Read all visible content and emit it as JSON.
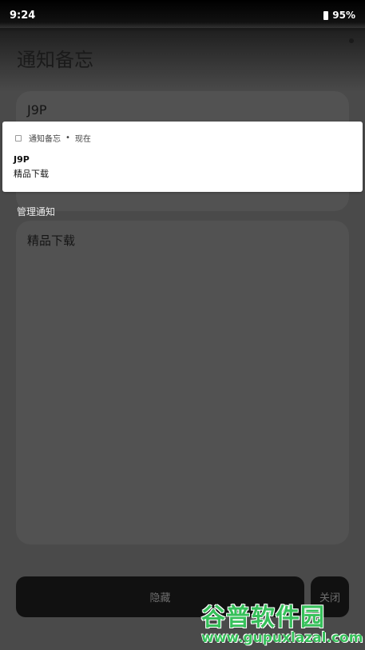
{
  "status_bar": {
    "time": "9:24",
    "battery": "95%"
  },
  "app": {
    "title": "通知备忘",
    "title_field_value": "J9P",
    "manage_label": "管理通知",
    "content_field_value": "精品下载",
    "hide_button_label": "隐藏",
    "close_button_label": "关闭"
  },
  "notification": {
    "app_name": "通知备忘",
    "separator": "•",
    "time": "现在",
    "title": "J9P",
    "text": "精品下载"
  },
  "watermark": {
    "brand": "谷普软件园",
    "url": "www.gupuxlazal.com"
  },
  "colors": {
    "scrim": "#4a4a4a",
    "card": "#525252",
    "button_bg": "#111111",
    "watermark_green": "#36c05a"
  }
}
